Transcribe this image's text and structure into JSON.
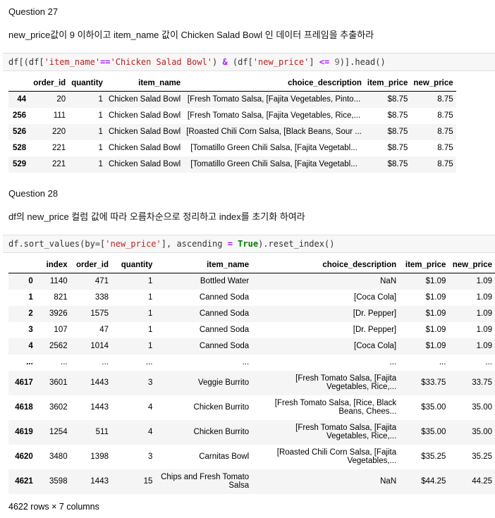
{
  "q27": {
    "title": "Question 27",
    "prompt": "new_price값이 9 이하이고 item_name 값이 Chicken Salad Bowl 인 데이터 프레임을 추출하라",
    "code": {
      "p1": "df[(df[",
      "s1": "'item_name'",
      "op1": "==",
      "s2": "'Chicken Salad Bowl'",
      "p2": ") ",
      "op2": "&",
      "p3": " (df[",
      "s3": "'new_price'",
      "p4": "] ",
      "op3": "<=",
      "p5": " ",
      "n1": "9",
      "p6": ")].head()"
    },
    "table": {
      "columns": [
        "",
        "order_id",
        "quantity",
        "item_name",
        "choice_description",
        "item_price",
        "new_price"
      ],
      "rows": [
        [
          "44",
          "20",
          "1",
          "Chicken Salad Bowl",
          "[Fresh Tomato Salsa, [Fajita Vegetables, Pinto...",
          "$8.75",
          "8.75"
        ],
        [
          "256",
          "111",
          "1",
          "Chicken Salad Bowl",
          "[Fresh Tomato Salsa, [Fajita Vegetables, Rice,...",
          "$8.75",
          "8.75"
        ],
        [
          "526",
          "220",
          "1",
          "Chicken Salad Bowl",
          "[Roasted Chili Corn Salsa, [Black Beans, Sour ...",
          "$8.75",
          "8.75"
        ],
        [
          "528",
          "221",
          "1",
          "Chicken Salad Bowl",
          "[Tomatillo Green Chili Salsa, [Fajita Vegetabl...",
          "$8.75",
          "8.75"
        ],
        [
          "529",
          "221",
          "1",
          "Chicken Salad Bowl",
          "[Tomatillo Green Chili Salsa, [Fajita Vegetabl...",
          "$8.75",
          "8.75"
        ]
      ]
    }
  },
  "q28": {
    "title": "Question 28",
    "prompt": "df의 new_price 컬럼 값에 따라 오름차순으로 정리하고 index를 초기화 하여라",
    "code": {
      "p1": "df.sort_values(by=[",
      "s1": "'new_price'",
      "p2": "], ascending ",
      "op1": "=",
      "p3": " ",
      "kw1": "True",
      "p4": ").reset_index()"
    },
    "table": {
      "columns": [
        "",
        "index",
        "order_id",
        "quantity",
        "item_name",
        "choice_description",
        "item_price",
        "new_price"
      ],
      "rows": [
        [
          "0",
          "1140",
          "471",
          "1",
          "Bottled Water",
          "NaN",
          "$1.09",
          "1.09"
        ],
        [
          "1",
          "821",
          "338",
          "1",
          "Canned Soda",
          "[Coca Cola]",
          "$1.09",
          "1.09"
        ],
        [
          "2",
          "3926",
          "1575",
          "1",
          "Canned Soda",
          "[Dr. Pepper]",
          "$1.09",
          "1.09"
        ],
        [
          "3",
          "107",
          "47",
          "1",
          "Canned Soda",
          "[Dr. Pepper]",
          "$1.09",
          "1.09"
        ],
        [
          "4",
          "2562",
          "1014",
          "1",
          "Canned Soda",
          "[Coca Cola]",
          "$1.09",
          "1.09"
        ],
        [
          "...",
          "...",
          "...",
          "...",
          "...",
          "...",
          "...",
          "..."
        ],
        [
          "4617",
          "3601",
          "1443",
          "3",
          "Veggie Burrito",
          "[Fresh Tomato Salsa, [Fajita Vegetables, Rice,...",
          "$33.75",
          "33.75"
        ],
        [
          "4618",
          "3602",
          "1443",
          "4",
          "Chicken Burrito",
          "[Fresh Tomato Salsa, [Rice, Black Beans, Chees...",
          "$35.00",
          "35.00"
        ],
        [
          "4619",
          "1254",
          "511",
          "4",
          "Chicken Burrito",
          "[Fresh Tomato Salsa, [Fajita Vegetables, Rice,...",
          "$35.00",
          "35.00"
        ],
        [
          "4620",
          "3480",
          "1398",
          "3",
          "Carnitas Bowl",
          "[Roasted Chili Corn Salsa, [Fajita Vegetables,...",
          "$35.25",
          "35.25"
        ],
        [
          "4621",
          "3598",
          "1443",
          "15",
          "Chips and Fresh Tomato Salsa",
          "NaN",
          "$44.25",
          "44.25"
        ]
      ]
    },
    "footer": "4622 rows × 7 columns"
  }
}
